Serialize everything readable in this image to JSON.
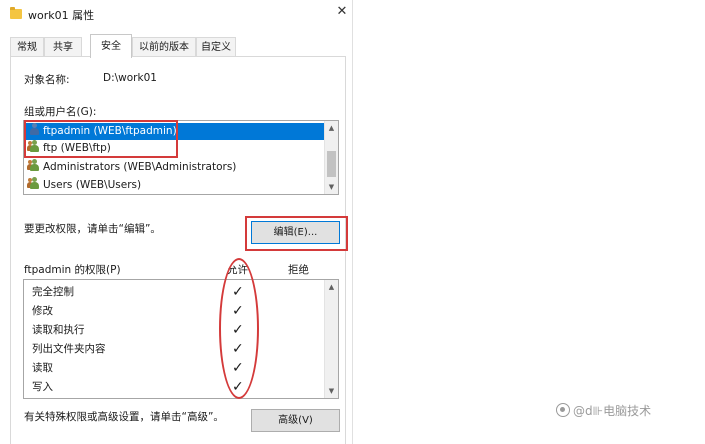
{
  "window": {
    "title": "work01 属性",
    "close_glyph": "✕"
  },
  "tabs": [
    {
      "label": "常规",
      "active": false
    },
    {
      "label": "共享",
      "active": false
    },
    {
      "label": "安全",
      "active": true
    },
    {
      "label": "以前的版本",
      "active": false
    },
    {
      "label": "自定义",
      "active": false
    }
  ],
  "security": {
    "object_name_label": "对象名称:",
    "object_name_value": "D:\\work01",
    "groups_label": "组或用户名(G):",
    "users": [
      {
        "name": "ftpadmin (WEB\\ftpadmin)",
        "icon": "user-icon",
        "selected": true
      },
      {
        "name": "ftp (WEB\\ftp)",
        "icon": "group-icon",
        "selected": false
      },
      {
        "name": "Administrators (WEB\\Administrators)",
        "icon": "group-icon",
        "selected": false
      },
      {
        "name": "Users (WEB\\Users)",
        "icon": "group-icon",
        "selected": false
      }
    ],
    "change_hint": "要更改权限，请单击“编辑”。",
    "edit_button": "编辑(E)...",
    "perms_label": "ftpadmin 的权限(P)",
    "allow_header": "允许",
    "deny_header": "拒绝",
    "permissions": [
      {
        "name": "完全控制",
        "allow": "✓",
        "deny": ""
      },
      {
        "name": "修改",
        "allow": "✓",
        "deny": ""
      },
      {
        "name": "读取和执行",
        "allow": "✓",
        "deny": ""
      },
      {
        "name": "列出文件夹内容",
        "allow": "✓",
        "deny": ""
      },
      {
        "name": "读取",
        "allow": "✓",
        "deny": ""
      },
      {
        "name": "写入",
        "allow": "✓",
        "deny": ""
      }
    ],
    "advanced_hint": "有关特殊权限或高级设置，请单击“高级”。",
    "advanced_button": "高级(V)"
  },
  "watermark": "@d⊪电脑技术",
  "colors": {
    "selection": "#0078d7",
    "annotation": "#d43a3a"
  }
}
